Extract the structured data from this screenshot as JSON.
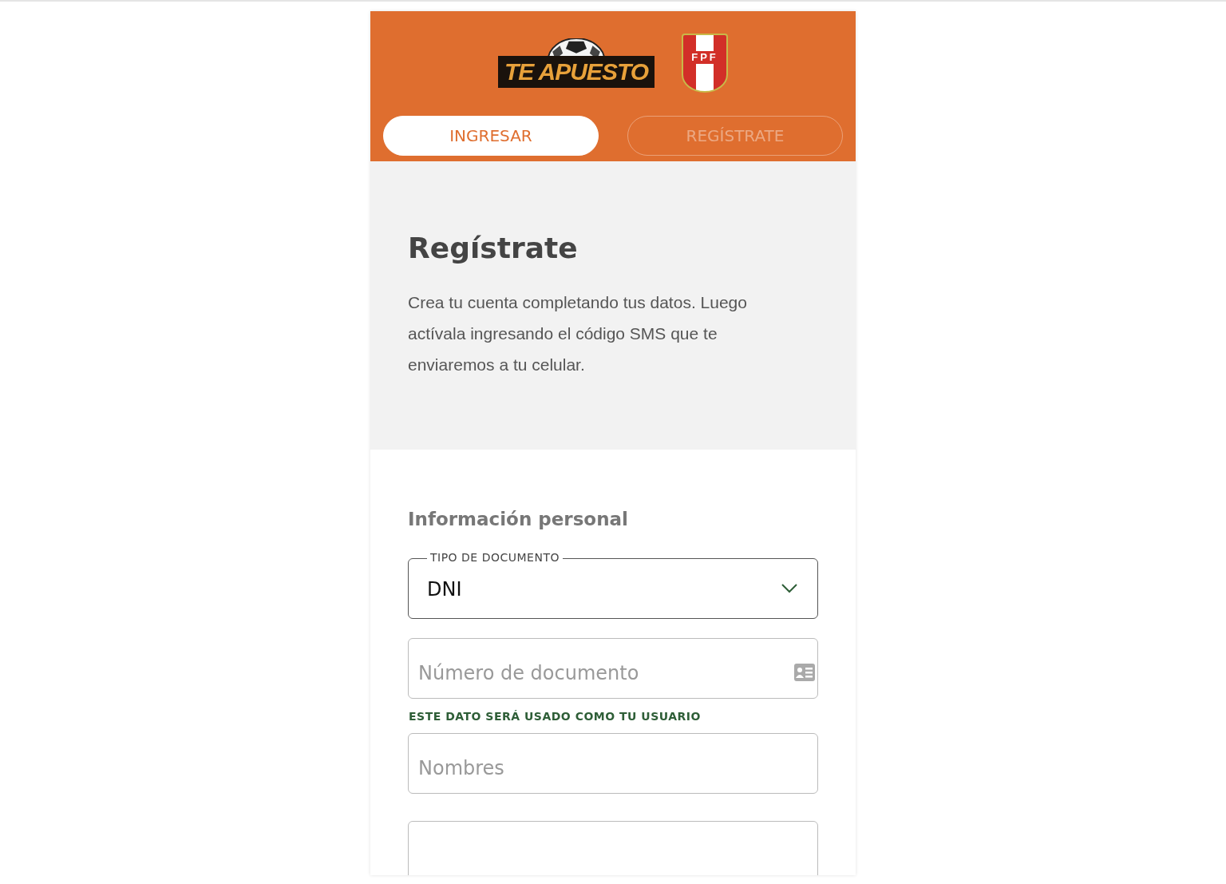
{
  "header": {
    "brand_logo": "TE APUESTO",
    "federation_logo": "FPF"
  },
  "tabs": [
    {
      "label": "INGRESAR",
      "selected": true
    },
    {
      "label": "REGÍSTRATE",
      "selected": false
    }
  ],
  "intro": {
    "title": "Regístrate",
    "text": "Crea tu cuenta completando tus datos. Luego actívala ingresando el código SMS que te enviaremos a tu celular."
  },
  "form": {
    "section_title": "Información personal",
    "fields": [
      {
        "kind": "select",
        "label": "TIPO DE DOCUMENTO",
        "value": "DNI"
      },
      {
        "kind": "id-input",
        "placeholder": "Número de documento",
        "hint": "ESTE DATO SERÁ USADO COMO TU USUARIO"
      },
      {
        "kind": "input",
        "placeholder": "Nombres"
      },
      {
        "kind": "input"
      }
    ]
  }
}
